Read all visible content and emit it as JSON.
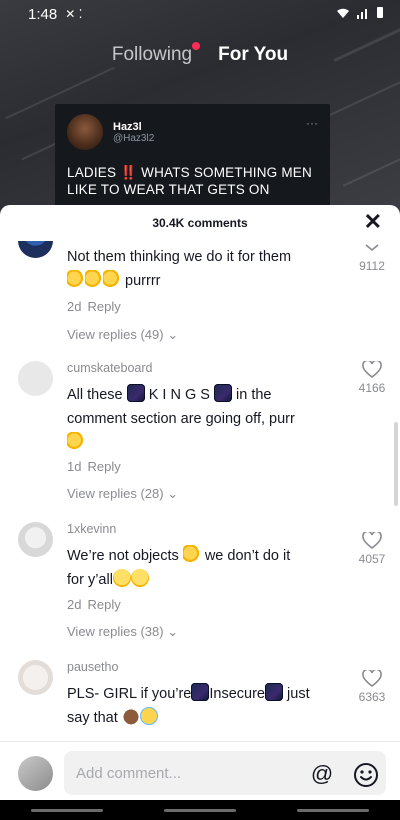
{
  "status_bar": {
    "time": "1:48",
    "icons": [
      "notification-icon",
      "wifi-icon",
      "signal-icon",
      "battery-icon"
    ]
  },
  "feed_tabs": {
    "following": "Following",
    "for_you": "For You"
  },
  "tweet": {
    "name": "Haz3l",
    "handle": "@Haz3l2",
    "text": "LADIES ‼️ WHATS SOMETHING MEN LIKE TO WEAR THAT GETS ON"
  },
  "comments_header": {
    "count": "30.4K comments",
    "close": "✕"
  },
  "comments": [
    {
      "username": "",
      "text": "Not them thinking we do it for them",
      "text2": "purrrr",
      "time": "2d",
      "reply": "Reply",
      "view_replies": "View replies (49)",
      "likes": "9112"
    },
    {
      "username": "cumskateboard",
      "text_a": "All these",
      "text_b": "K I N G S",
      "text_c": "in the",
      "text_line2": "comment section are going off, purr",
      "time": "1d",
      "reply": "Reply",
      "view_replies": "View replies (28)",
      "likes": "4166"
    },
    {
      "username": "1xkevinn",
      "text_a": "We’re not objects",
      "text_b": "we don’t do it",
      "text_line2": "for y’all",
      "time": "2d",
      "reply": "Reply",
      "view_replies": "View replies (38)",
      "likes": "4057"
    },
    {
      "username": "pausetho",
      "text_a": "PLS- GIRL if you’re",
      "text_b": "Insecure",
      "text_c": "just",
      "text_line2": "say that",
      "likes": "6363"
    }
  ],
  "input": {
    "placeholder": "Add comment...",
    "at_symbol": "@"
  },
  "colors": {
    "accent": "#fe2c55",
    "text": "#161823",
    "muted": "#8a8b91",
    "sheet_bg": "#ffffff"
  }
}
